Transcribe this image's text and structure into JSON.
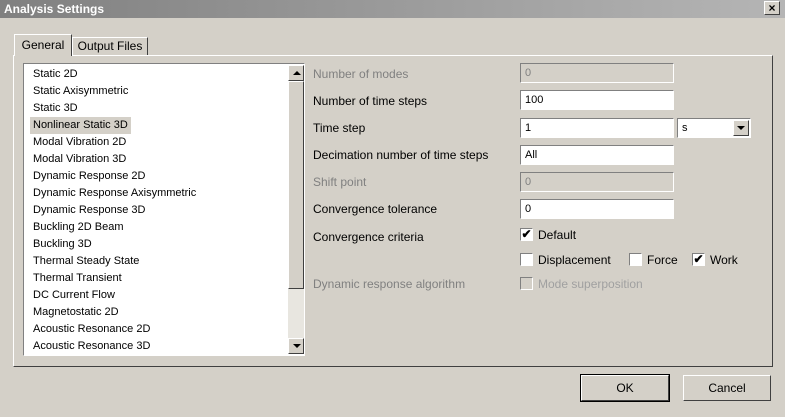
{
  "window": {
    "title": "Analysis Settings",
    "close_glyph": "×"
  },
  "tabs": [
    {
      "label": "General"
    },
    {
      "label": "Output Files"
    }
  ],
  "analysis_types": [
    "Static 2D",
    "Static Axisymmetric",
    "Static 3D",
    "Nonlinear Static 3D",
    "Modal Vibration 2D",
    "Modal Vibration 3D",
    "Dynamic Response 2D",
    "Dynamic Response Axisymmetric",
    "Dynamic Response 3D",
    "Buckling 2D Beam",
    "Buckling 3D",
    "Thermal Steady State",
    "Thermal Transient",
    "DC Current Flow",
    "Magnetostatic 2D",
    "Acoustic Resonance 2D",
    "Acoustic Resonance 3D"
  ],
  "selected_analysis": "Nonlinear Static 3D",
  "settings": {
    "modes_label": "Number of modes",
    "modes_value": "0",
    "time_steps_label": "Number of time steps",
    "time_steps_value": "100",
    "time_step_label": "Time step",
    "time_step_value": "1",
    "time_step_unit": "s",
    "decimation_label": "Decimation number of time steps",
    "decimation_value": "All",
    "shift_label": "Shift point",
    "shift_value": "0",
    "tolerance_label": "Convergence tolerance",
    "tolerance_value": "0",
    "criteria_label": "Convergence criteria",
    "default_label": "Default",
    "default_checked": true,
    "displacement_label": "Displacement",
    "displacement_checked": false,
    "force_label": "Force",
    "force_checked": false,
    "work_label": "Work",
    "work_checked": true,
    "algorithm_label": "Dynamic response algorithm",
    "mode_superposition_label": "Mode superposition",
    "mode_superposition_checked": false
  },
  "buttons": {
    "ok": "OK",
    "cancel": "Cancel"
  },
  "icons": {
    "check": "✔",
    "scroll_up": "triangle-up-icon",
    "scroll_down": "triangle-down-icon"
  }
}
